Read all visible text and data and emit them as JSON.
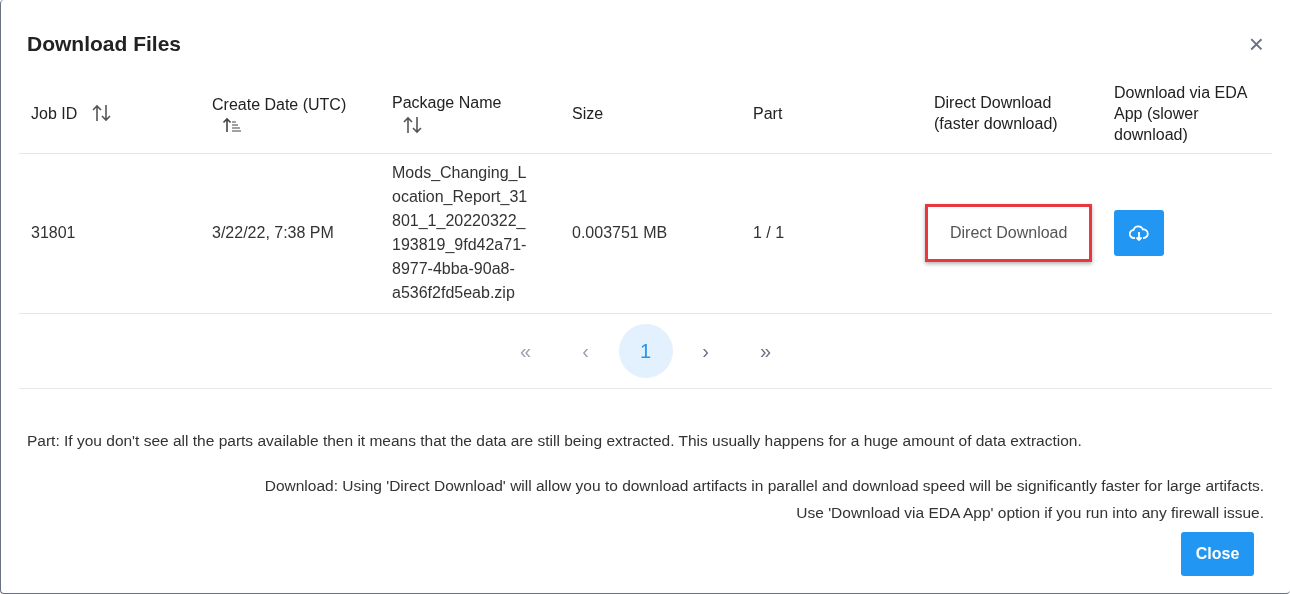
{
  "dialog": {
    "title": "Download Files",
    "close_icon": "×"
  },
  "table": {
    "columns": [
      {
        "label": "Job ID",
        "kind": "sortable"
      },
      {
        "label": "Create Date (UTC)",
        "kind": "sorted"
      },
      {
        "label": "Package Name",
        "kind": "sortable"
      },
      {
        "label": "Size",
        "kind": "plain"
      },
      {
        "label": "Part",
        "kind": "plain"
      },
      {
        "label": "Direct Download (faster download)",
        "kind": "plain"
      },
      {
        "label": "Download via EDA App (slower download)",
        "kind": "plain"
      }
    ],
    "rows": [
      {
        "job_id": "31801",
        "create_date": "3/22/22, 7:38 PM",
        "package_name": "Mods_Changing_Location_Report_31801_1_20220322_193819_9fd42a71-8977-4bba-90a8-a536f2fd5eab.zip",
        "size": "0.003751 MB",
        "part": "1 / 1",
        "direct_link": {
          "label": "Direct Download",
          "highlighted": true
        },
        "app_download": {
          "kind": "cloud-button"
        }
      }
    ]
  },
  "pagination": {
    "items": [
      {
        "label": "«",
        "disabled": true,
        "selected": false
      },
      {
        "label": "‹",
        "disabled": true,
        "selected": false
      },
      {
        "label": "1",
        "disabled": false,
        "selected": true
      },
      {
        "label": "›",
        "disabled": false,
        "selected": false
      },
      {
        "label": "»",
        "disabled": false,
        "selected": false
      }
    ]
  },
  "notes": [
    {
      "text": "Part: If you don't see all the parts available then it means that the data are still being extracted. This usually happens for a huge amount of data extraction.",
      "kind": "left"
    },
    {
      "text": "Download: Using 'Direct Download' will allow you to download artifacts in parallel and download speed will be significantly faster for large artifacts.",
      "kind": "right"
    },
    {
      "text": "Use 'Download via EDA App' option if you run into any firewall issue.",
      "kind": "right"
    }
  ],
  "buttons": [
    {
      "label": "Close"
    }
  ]
}
